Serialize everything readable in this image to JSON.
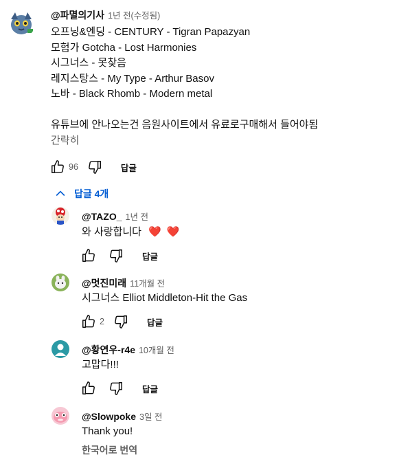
{
  "comment": {
    "author": "@파멸의기사",
    "time": "1년 전(수정됨)",
    "lines": [
      "오프닝&엔딩 - CENTURY - Tigran Papazyan",
      "모험가 Gotcha - Lost Harmonies",
      "시그너스 - 못찾음",
      "레지스탕스 - My Type - Arthur Basov",
      "노바 - Black Rhomb - Modern metal",
      "",
      "유튜브에 안나오는건 음원사이트에서 유료로구매해서 들어야됨",
      "간략히"
    ],
    "likes": "96",
    "reply_label": "답글"
  },
  "replies_toggle": {
    "label": "답글 4개"
  },
  "replies": [
    {
      "author": "@TAZO_",
      "time": "1년 전",
      "text": "와 사랑합니다",
      "hearts": "❤️ ❤️",
      "likes": "",
      "reply_label": "답글"
    },
    {
      "author": "@멋진미래",
      "time": "11개월 전",
      "text": "시그너스 Elliot Middleton-Hit the Gas",
      "likes": "2",
      "reply_label": "답글"
    },
    {
      "author": "@황연우-r4e",
      "time": "10개월 전",
      "text": "고맙다!!!",
      "likes": "",
      "reply_label": "답글"
    },
    {
      "author": "@Slowpoke",
      "time": "3일 전",
      "text": "Thank you!",
      "translate": "한국어로 번역",
      "likes": "",
      "reply_label": "답글"
    }
  ],
  "colors": {
    "link": "#065fd4",
    "secondary_text": "#606060",
    "avatar_teal": "#2b9aa5",
    "heart": "#e02020"
  },
  "icons": [
    "like-icon",
    "dislike-icon",
    "chevron-up-icon",
    "heart-icon"
  ]
}
